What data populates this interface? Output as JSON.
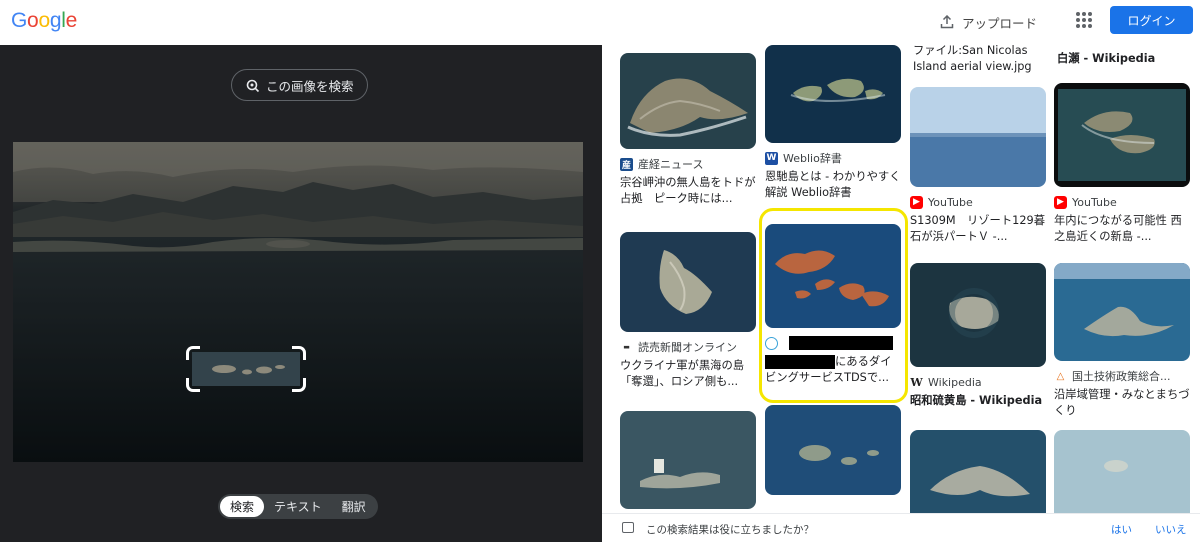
{
  "header": {
    "logo_letters": [
      {
        "ch": "G",
        "color": "#4285F4"
      },
      {
        "ch": "o",
        "color": "#EA4335"
      },
      {
        "ch": "o",
        "color": "#FBBC05"
      },
      {
        "ch": "g",
        "color": "#4285F4"
      },
      {
        "ch": "l",
        "color": "#34A853"
      },
      {
        "ch": "e",
        "color": "#EA4335"
      }
    ],
    "upload_label": "アップロード",
    "upload_icon": "upload-icon",
    "apps_icon": "apps-grid-icon",
    "login_label": "ログイン"
  },
  "left": {
    "search_image_label": "この画像を検索",
    "search_image_icon": "lens-search-icon",
    "tabs": [
      {
        "label": "検索",
        "active": true
      },
      {
        "label": "テキスト",
        "active": false
      },
      {
        "label": "翻訳",
        "active": false
      }
    ]
  },
  "results": [
    {
      "id": "r1",
      "thumb_style": "island-coast",
      "source": "",
      "title": "ファイル:San Nicolas Island aerial view.jpg -..."
    },
    {
      "id": "r2",
      "thumb_style": "top-dark",
      "source": "",
      "title": "白瀬 - Wikipedia"
    },
    {
      "id": "r3",
      "thumb_style": "island-coast",
      "source": "産経ニュース",
      "title": "宗谷岬沖の無人島をトドが占拠　ピーク時には..."
    },
    {
      "id": "r4",
      "thumb_style": "islands-dark",
      "source": "Weblio辞書",
      "title": "恩馳島とは - わかりやすく解説 Weblio辞書"
    },
    {
      "id": "r5",
      "thumb_style": "sea-horizon",
      "source": "YouTube",
      "title": "S1309M　リゾート129暮石が浜パートＶ -..."
    },
    {
      "id": "r6",
      "thumb_style": "islands-black",
      "source": "YouTube",
      "title": "年内につながる可能性 西之島近くの新島 -..."
    },
    {
      "id": "r7",
      "thumb_style": "island-aerial",
      "source": "読売新聞オンライン",
      "title": "ウクライナ軍が黒海の島「奪還」、ロシア側も..."
    },
    {
      "id": "r8",
      "thumb_style": "islands-blue",
      "source": "",
      "title": "にあるダイビングサービスTDSで..."
    },
    {
      "id": "r9",
      "thumb_style": "island-round",
      "source": "Wikipedia",
      "title": "昭和硫黄島 - Wikipedia"
    },
    {
      "id": "r10",
      "thumb_style": "island-sea-blue",
      "source": "国土技術政策総合...",
      "title": "沿岸域管理・みなとまちづくり"
    },
    {
      "id": "r11",
      "thumb_style": "island-ship",
      "source": "",
      "title": ""
    },
    {
      "id": "r12",
      "thumb_style": "islands-small",
      "source": "",
      "title": ""
    },
    {
      "id": "r13",
      "thumb_style": "island-coast-blue",
      "source": "",
      "title": ""
    },
    {
      "id": "r14",
      "thumb_style": "island-sea-pale",
      "source": "",
      "title": ""
    }
  ],
  "feedback": {
    "question": "この検索結果は役に立ちましたか？",
    "yes": "はい",
    "no": "いいえ"
  },
  "colors": {
    "accent": "#1a73e8",
    "highlight": "#f5e600",
    "dark_panel": "#202124"
  }
}
